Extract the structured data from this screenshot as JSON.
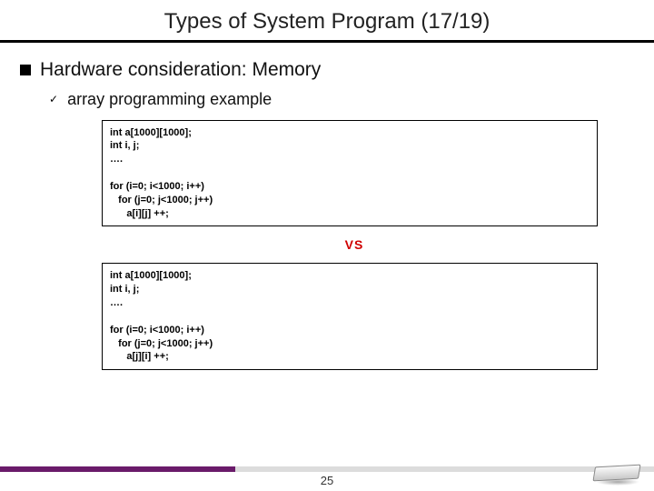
{
  "title": "Types of System Program (17/19)",
  "heading1": "Hardware consideration: Memory",
  "heading2": "array programming example",
  "code1": "int a[1000][1000];\nint i, j;\n….\n\nfor (i=0; i<1000; i++)\n   for (j=0; j<1000; j++)\n      a[i][j] ++;",
  "vs_label": "VS",
  "code2": "int a[1000][1000];\nint i, j;\n….\n\nfor (i=0; i<1000; i++)\n   for (j=0; j<1000; j++)\n      a[j][i] ++;",
  "page_number": "25"
}
